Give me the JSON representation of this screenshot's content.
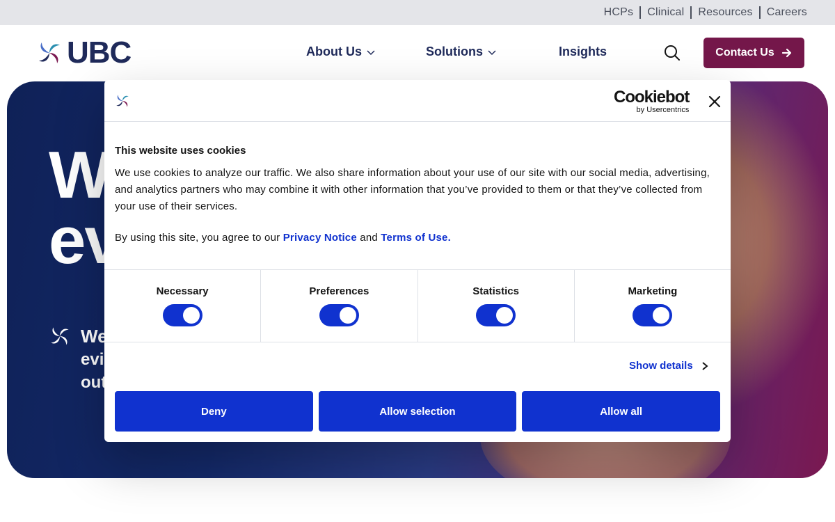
{
  "utility_nav": [
    "HCPs",
    "Clinical",
    "Resources",
    "Careers"
  ],
  "header": {
    "logo_text": "UBC",
    "nav": {
      "about": "About Us",
      "solutions": "Solutions",
      "insights": "Insights"
    },
    "contact": "Contact Us"
  },
  "hero": {
    "headline_line1": "W",
    "headline_line2": "ev",
    "sub_line1": "We",
    "sub_line2": "evi",
    "sub_line3": "out"
  },
  "cookie_dialog": {
    "brand_main": "Cookiebot",
    "brand_sub": "by Usercentrics",
    "title": "This website uses cookies",
    "body": "We use cookies to analyze our traffic. We also share information about your use of our site with our social media, advertising, and analytics partners who may combine it with other information that you’ve provided to them or that they’ve collected from your use of their services.",
    "consent_prefix": "By using this site, you agree to our ",
    "privacy_link": "Privacy Notice",
    "consent_and": " and ",
    "terms_link": "Terms of Use.",
    "toggles": [
      {
        "label": "Necessary",
        "state": "on"
      },
      {
        "label": "Preferences",
        "state": "on"
      },
      {
        "label": "Statistics",
        "state": "on"
      },
      {
        "label": "Marketing",
        "state": "on"
      }
    ],
    "show_details": "Show details",
    "buttons": {
      "deny": "Deny",
      "allow_selection": "Allow selection",
      "allow_all": "Allow all"
    }
  },
  "colors": {
    "brand_navy": "#1f2a5a",
    "contact_button": "#74174a",
    "cookiebot_blue": "#1032cf"
  }
}
